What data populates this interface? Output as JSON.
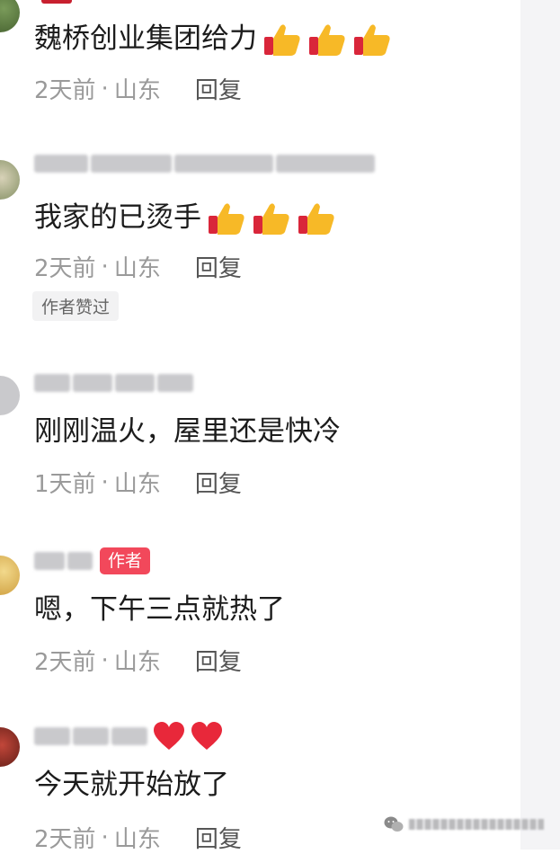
{
  "comments": [
    {
      "text": "魏桥创业集团给力",
      "time": "2天前",
      "sep": "·",
      "location": "山东",
      "reply": "回复",
      "emoji": [
        "thumbs-up-icon",
        "thumbs-up-icon",
        "thumbs-up-icon"
      ]
    },
    {
      "text": "我家的已烫手",
      "time": "2天前",
      "sep": "·",
      "location": "山东",
      "reply": "回复",
      "liked_tag": "作者赞过",
      "emoji": [
        "thumbs-up-icon",
        "thumbs-up-icon",
        "thumbs-up-icon"
      ]
    },
    {
      "text": "刚刚温火，屋里还是快冷",
      "time": "1天前",
      "sep": "·",
      "location": "山东",
      "reply": "回复"
    },
    {
      "author_badge": "作者",
      "text": "嗯，下午三点就热了",
      "time": "2天前",
      "sep": "·",
      "location": "山东",
      "reply": "回复"
    },
    {
      "name_emoji": [
        "heart-icon",
        "heart-icon"
      ],
      "text": "今天就开始放了",
      "time": "2天前",
      "sep": "·",
      "location": "山东",
      "reply": "回复"
    }
  ],
  "colors": {
    "author_badge": "#f2485b",
    "meta_text": "#9a9a9a",
    "heart": "#e8283a"
  },
  "watermark_icon": "wechat-icon"
}
